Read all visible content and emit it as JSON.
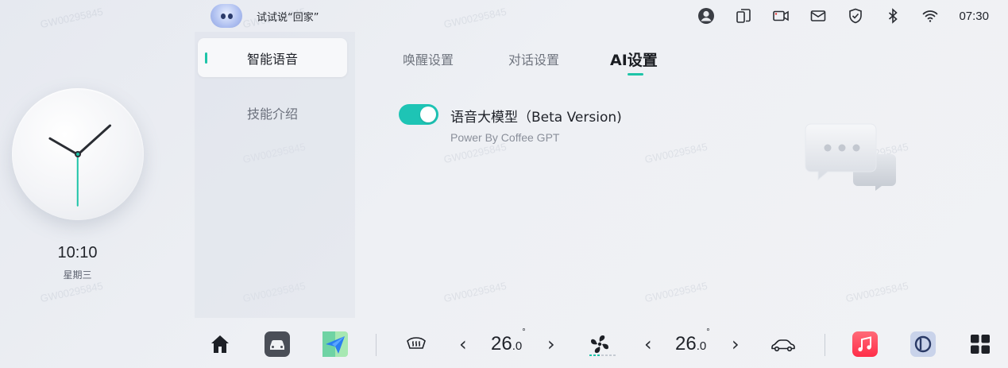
{
  "watermark": "GW00295845",
  "clock": {
    "time": "10:10",
    "day": "星期三"
  },
  "topbar": {
    "assistant_hint": "试试说“回家”",
    "time": "07:30",
    "icons": [
      "user-avatar-icon",
      "phone-mirror-icon",
      "dashcam-icon",
      "message-icon",
      "shield-icon",
      "bluetooth-icon",
      "wifi-icon"
    ]
  },
  "sidebar": {
    "items": [
      {
        "label": "智能语音",
        "active": true
      },
      {
        "label": "技能介绍",
        "active": false
      }
    ]
  },
  "tabs": [
    {
      "label": "唤醒设置",
      "active": false
    },
    {
      "label": "对话设置",
      "active": false
    },
    {
      "label": "AI设置",
      "active": true
    }
  ],
  "setting": {
    "title": "语音大模型（Beta Version)",
    "subtitle": "Power By Coffee GPT",
    "enabled": true
  },
  "dock": {
    "left_temp": {
      "main": "26",
      "decimal": ".0",
      "unit": "°"
    },
    "right_temp": {
      "main": "26",
      "decimal": ".0",
      "unit": "°"
    },
    "fan_level": 3,
    "fan_max": 7
  },
  "colors": {
    "accent": "#1ec4b5",
    "background": "#eceef2"
  }
}
